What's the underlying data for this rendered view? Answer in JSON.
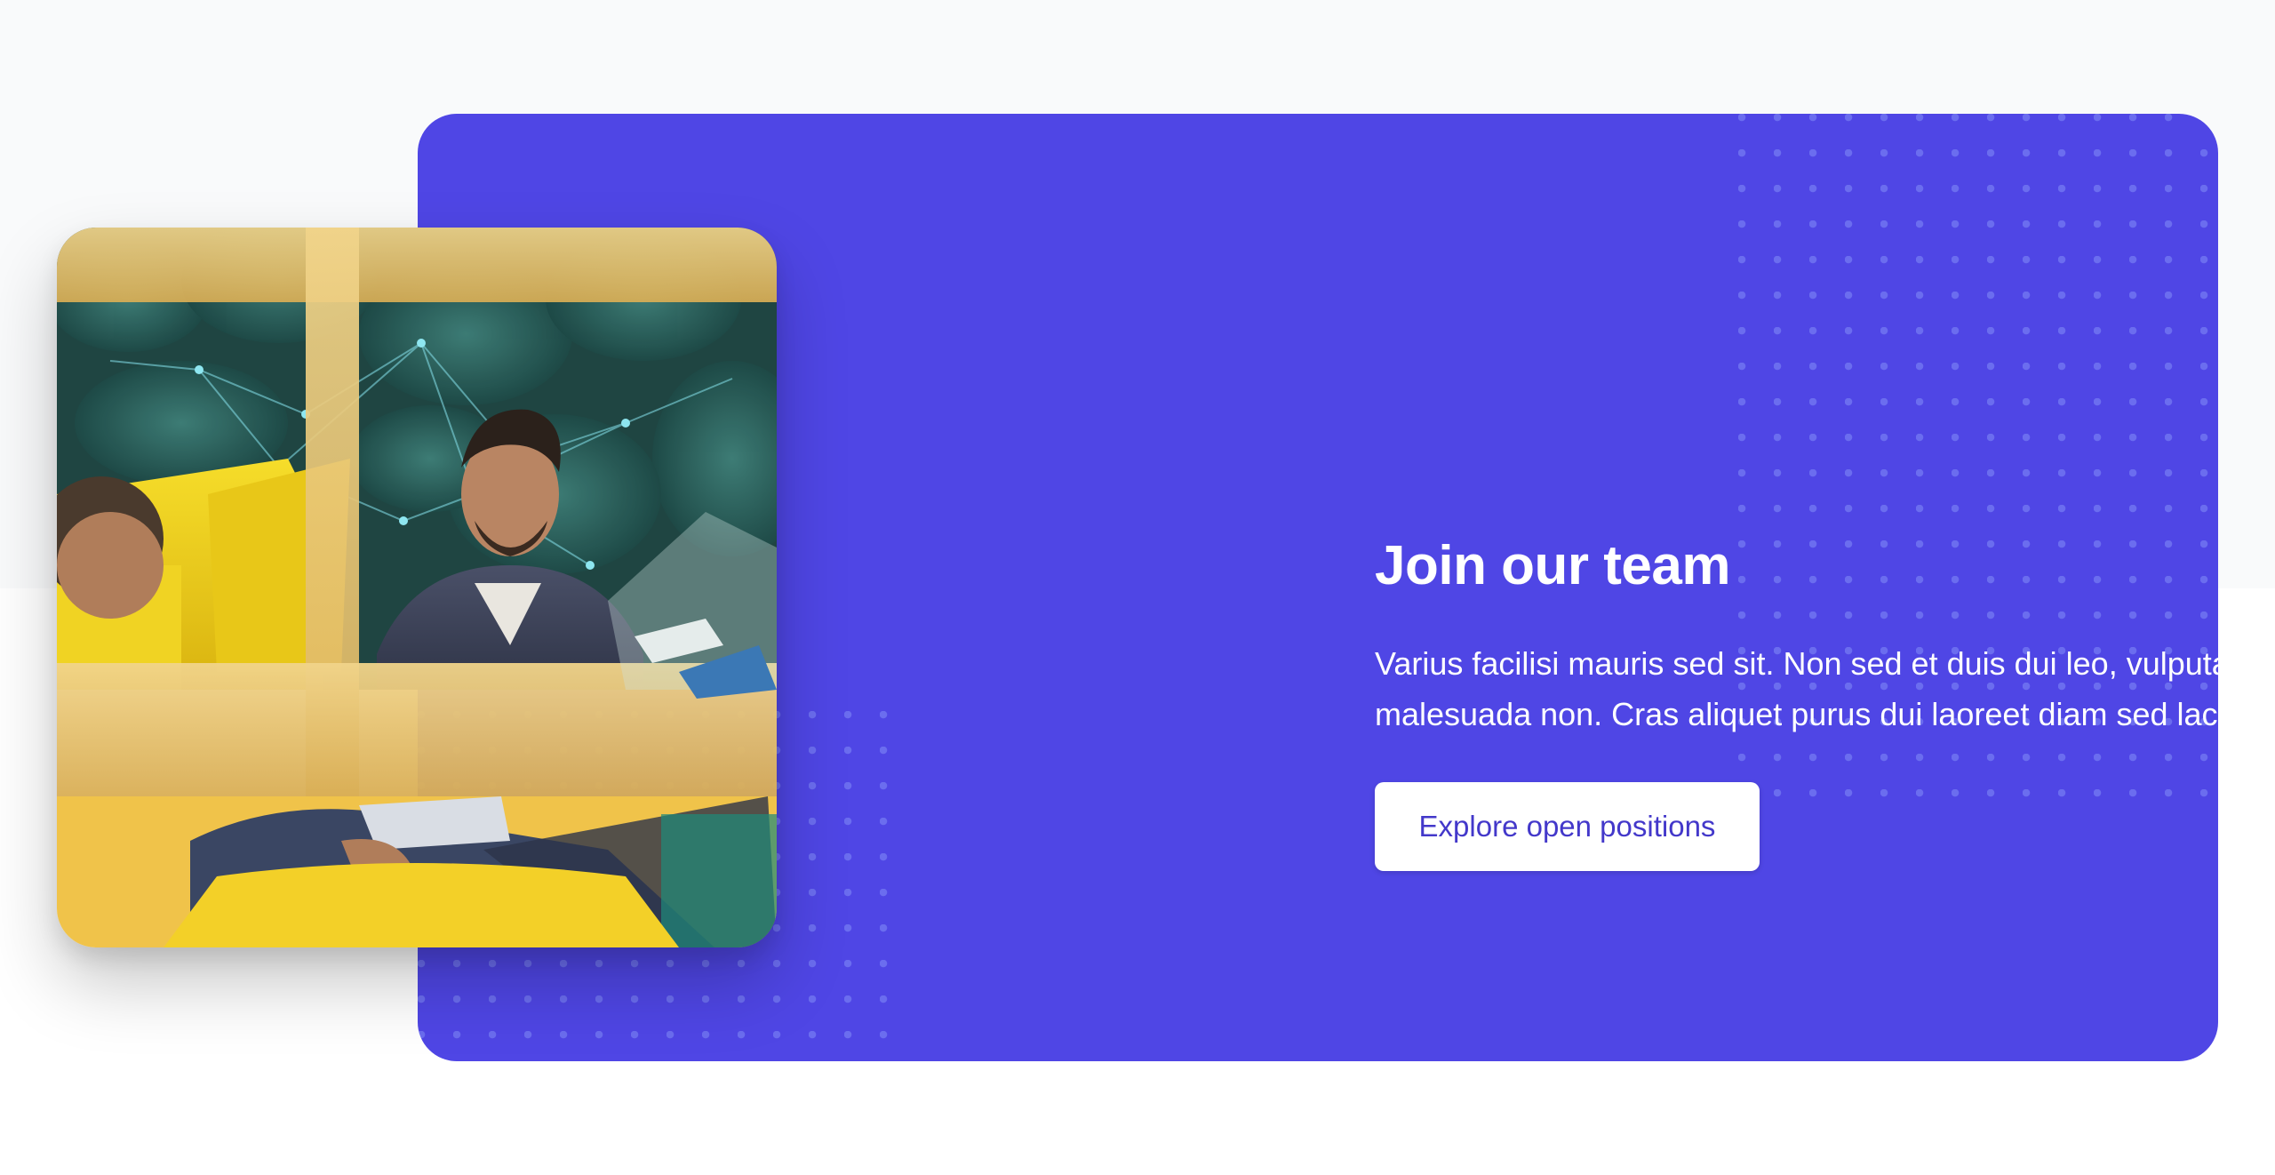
{
  "section": {
    "heading": "Join our team",
    "description": "Varius facilisi mauris sed sit. Non sed et duis dui leo, vulputate id malesuada non. Cras aliquet purus dui laoreet diam sed lacus, fames.",
    "cta_label": "Explore open positions"
  },
  "colors": {
    "page_top": "#f9fafb",
    "page_bottom": "#ffffff",
    "card_background": "#4f46e5",
    "dot_pattern": "#818cf8",
    "button_background": "#ffffff",
    "button_text": "#4338ca",
    "text": "#ffffff"
  },
  "image": {
    "subject": "team-members-in-office-photo"
  }
}
